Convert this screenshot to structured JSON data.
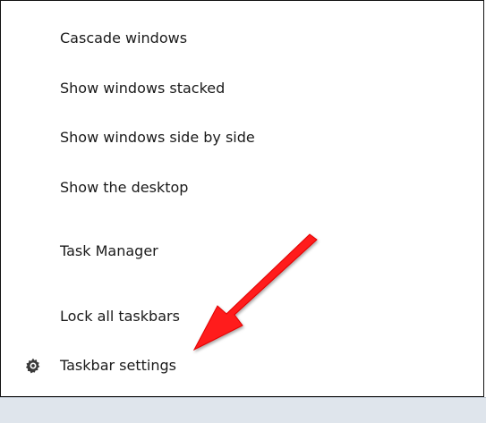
{
  "menu": {
    "items": [
      {
        "label": "Cascade windows"
      },
      {
        "label": "Show windows stacked"
      },
      {
        "label": "Show windows side by side"
      },
      {
        "label": "Show the desktop"
      },
      {
        "label": "Task Manager"
      },
      {
        "label": "Lock all taskbars"
      },
      {
        "label": "Taskbar settings",
        "icon": "gear-icon"
      }
    ]
  },
  "annotation": {
    "arrow_color": "#ff1a1a"
  }
}
